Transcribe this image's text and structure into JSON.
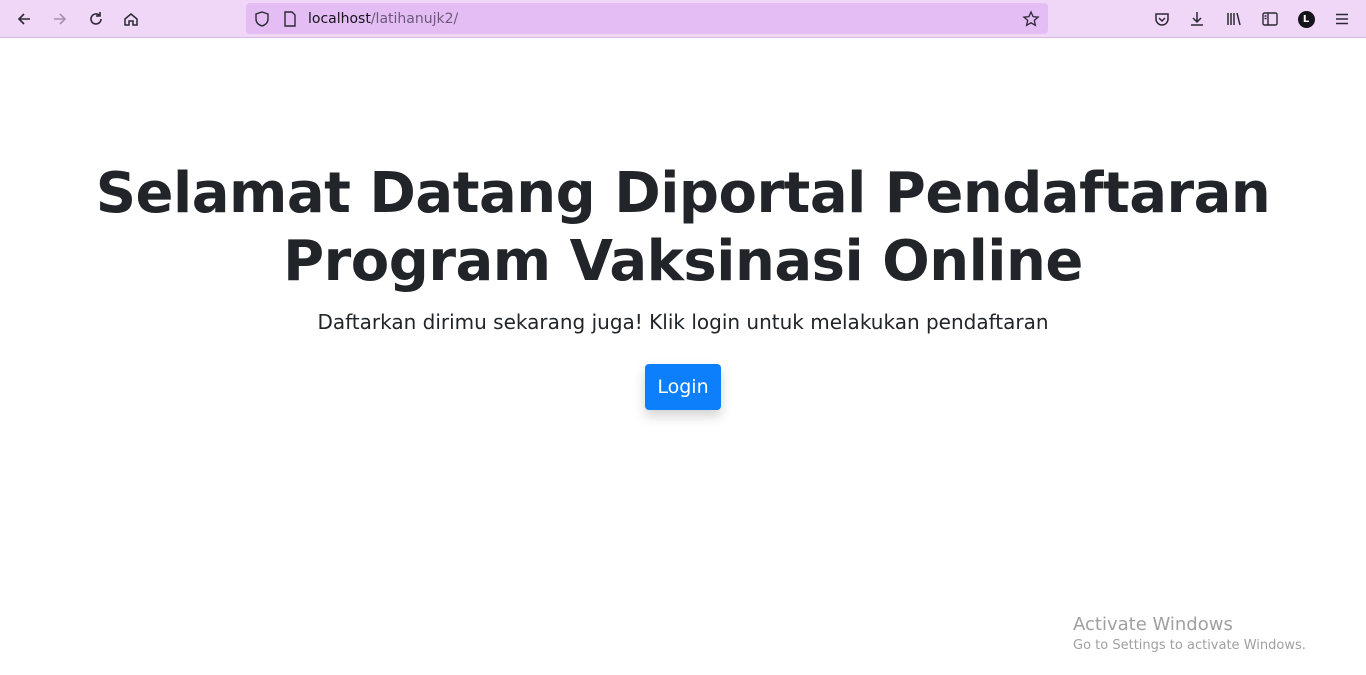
{
  "browser": {
    "url_host": "localhost",
    "url_path": "/latihanujk2/",
    "icons": [
      "back-icon",
      "forward-icon",
      "reload-icon",
      "home-icon",
      "shield-icon",
      "page-icon",
      "bookmark-star-icon",
      "pocket-icon",
      "download-icon",
      "library-icon",
      "sidebar-icon",
      "account-icon",
      "menu-icon"
    ],
    "account_initial": "L"
  },
  "page": {
    "title": "Selamat Datang Diportal Pendaftaran Program Vaksinasi Online",
    "subtitle": "Daftarkan dirimu sekarang juga! Klik login untuk melakukan pendaftaran",
    "login_label": "Login"
  },
  "watermark": {
    "line1": "Activate Windows",
    "line2": "Go to Settings to activate Windows."
  },
  "colors": {
    "toolbar": "#f0d6f7",
    "urlbar": "#e3bdf4",
    "button": "#0d7ffb",
    "text": "#212529"
  }
}
